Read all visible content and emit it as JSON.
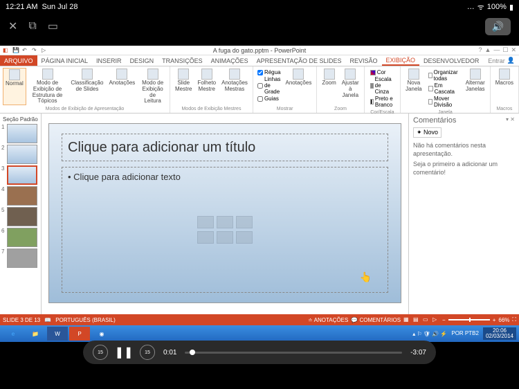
{
  "ios": {
    "time": "12:21 AM",
    "date": "Sun Jul 28",
    "battery": "100%"
  },
  "window_title": "A fuga do gato.pptm - PowerPoint",
  "signin": "Entrar",
  "tabs": {
    "file": "ARQUIVO",
    "items": [
      "PÁGINA INICIAL",
      "INSERIR",
      "DESIGN",
      "TRANSIÇÕES",
      "ANIMAÇÕES",
      "APRESENTAÇÃO DE SLIDES",
      "REVISÃO",
      "EXIBIÇÃO",
      "DESENVOLVEDOR"
    ],
    "active": "EXIBIÇÃO"
  },
  "ribbon": {
    "views": {
      "normal": "Normal",
      "outline": "Modo de Exibição de Estrutura de Tópicos",
      "sorter": "Classificação de Slides",
      "notes": "Anotações",
      "reading": "Modo de Exibição de Leitura",
      "group_label": "Modos de Exibição de Apresentação"
    },
    "masters": {
      "slide": "Slide Mestre",
      "handout": "Folheto Mestre",
      "notes": "Anotações Mestras",
      "group_label": "Modos de Exibição Mestres"
    },
    "show": {
      "ruler": "Régua",
      "gridlines": "Linhas de Grade",
      "guides": "Guias",
      "notes_btn": "Anotações",
      "group_label": "Mostrar"
    },
    "zoom": {
      "zoom": "Zoom",
      "fit": "Ajustar à Janela",
      "group_label": "Zoom"
    },
    "color": {
      "color": "Cor",
      "gray": "Escala de Cinza",
      "bw": "Preto e Branco",
      "group_label": "Cor/Escala de Cinza"
    },
    "window": {
      "new": "Nova Janela",
      "arrange": "Organizar todas",
      "cascade": "Em Cascata",
      "split": "Mover Divisão",
      "switch": "Alternar Janelas",
      "group_label": "Janela"
    },
    "macros": {
      "macros": "Macros",
      "group_label": "Macros"
    }
  },
  "thumbs": {
    "section": "Seção Padrão",
    "count": 7,
    "selected": 3
  },
  "slide": {
    "title_placeholder": "Clique para adicionar um título",
    "body_placeholder": "• Clique para adicionar texto"
  },
  "comments": {
    "header": "Comentários",
    "new": "Novo",
    "empty1": "Não há comentários nesta apresentação.",
    "empty2": "Seja o primeiro a adicionar um comentário!"
  },
  "status": {
    "slide": "SLIDE 3 DE 13",
    "lang": "PORTUGUÊS (BRASIL)",
    "notes": "ANOTAÇÕES",
    "comments": "COMENTÁRIOS",
    "zoom": "66%"
  },
  "taskbar": {
    "lang": "POR PTB2",
    "time": "20:06",
    "date": "02/03/2014"
  },
  "player": {
    "elapsed": "0:01",
    "remaining": "-3:07"
  }
}
